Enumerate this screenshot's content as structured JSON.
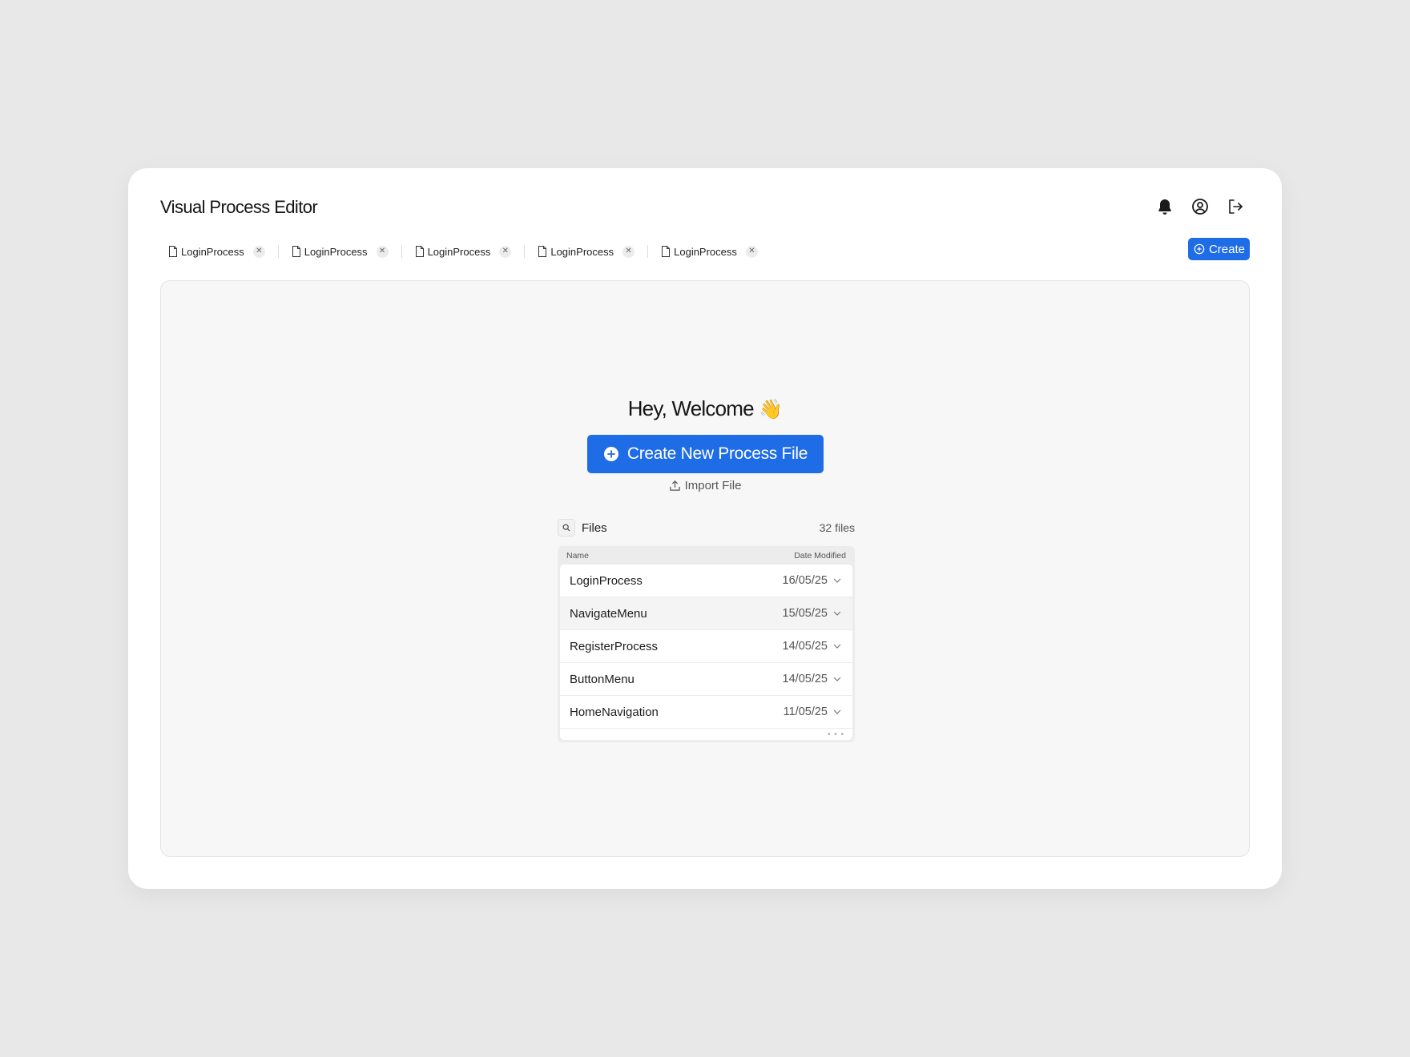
{
  "app": {
    "title": "Visual Process Editor"
  },
  "header": {
    "icons": [
      "bell-icon",
      "user-circle-icon",
      "logout-icon"
    ]
  },
  "tabs": [
    {
      "label": "LoginProcess"
    },
    {
      "label": "LoginProcess"
    },
    {
      "label": "LoginProcess"
    },
    {
      "label": "LoginProcess"
    },
    {
      "label": "LoginProcess"
    }
  ],
  "toolbar": {
    "create_label": "Create"
  },
  "welcome": {
    "heading": "Hey, Welcome",
    "emoji": "👋",
    "cta_label": "Create New Process File",
    "import_label": "Import File"
  },
  "files": {
    "label": "Files",
    "count": "32 files",
    "columns": {
      "name": "Name",
      "date": "Date Modified"
    },
    "rows": [
      {
        "name": "LoginProcess",
        "date": "16/05/25"
      },
      {
        "name": "NavigateMenu",
        "date": "15/05/25"
      },
      {
        "name": "RegisterProcess",
        "date": "14/05/25"
      },
      {
        "name": "ButtonMenu",
        "date": "14/05/25"
      },
      {
        "name": "HomeNavigation",
        "date": "11/05/25"
      }
    ],
    "more": "• • •"
  },
  "colors": {
    "accent": "#1e6ce6",
    "background": "#e8e8e8",
    "canvas": "#f7f7f7"
  }
}
